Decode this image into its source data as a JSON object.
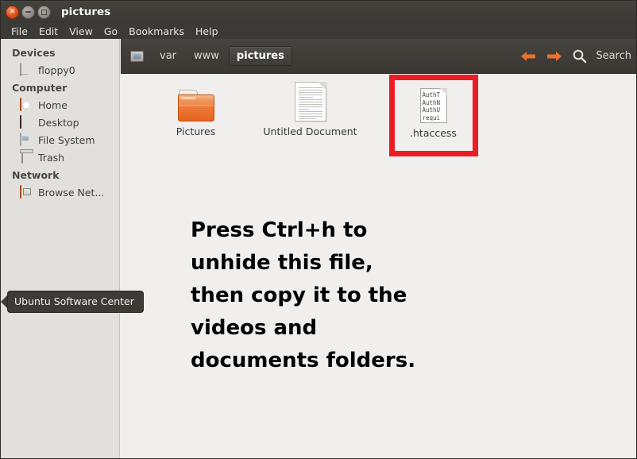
{
  "window": {
    "title": "pictures",
    "controls": {
      "close": "close-button",
      "minimize": "minimize-button",
      "maximize": "maximize-button"
    }
  },
  "menubar": {
    "items": [
      {
        "label": "File"
      },
      {
        "label": "Edit"
      },
      {
        "label": "View"
      },
      {
        "label": "Go"
      },
      {
        "label": "Bookmarks"
      },
      {
        "label": "Help"
      }
    ]
  },
  "sidebar": {
    "sections": [
      {
        "heading": "Devices",
        "items": [
          {
            "label": "floppy0",
            "icon": "floppy-drive-icon"
          }
        ]
      },
      {
        "heading": "Computer",
        "items": [
          {
            "label": "Home",
            "icon": "home-folder-icon"
          },
          {
            "label": "Desktop",
            "icon": "desktop-icon"
          },
          {
            "label": "File System",
            "icon": "file-system-icon"
          },
          {
            "label": "Trash",
            "icon": "trash-icon"
          }
        ]
      },
      {
        "heading": "Network",
        "items": [
          {
            "label": "Browse Net...",
            "icon": "network-folder-icon"
          }
        ]
      }
    ]
  },
  "toolbar": {
    "path_icon": "drive-icon",
    "breadcrumbs": [
      {
        "label": "var",
        "active": false
      },
      {
        "label": "www",
        "active": false
      },
      {
        "label": "pictures",
        "active": true
      }
    ],
    "back_icon": "back-arrow-icon",
    "forward_icon": "forward-arrow-icon",
    "search_icon": "search-icon",
    "search_label": "Search"
  },
  "files": [
    {
      "name": "Pictures",
      "type": "folder",
      "icon": "folder-icon",
      "highlighted": false
    },
    {
      "name": "Untitled Document",
      "type": "document",
      "icon": "document-icon",
      "highlighted": false
    },
    {
      "name": ".htaccess",
      "type": "text-file",
      "icon": "text-file-icon",
      "highlighted": true,
      "preview_lines": [
        "AuthT",
        "AuthN",
        "AuthU",
        "requi"
      ]
    }
  ],
  "instructions": {
    "lines": [
      "Press Ctrl+h to",
      "unhide this file,",
      "then copy it to the",
      "videos and",
      "documents folders."
    ]
  },
  "tooltip": {
    "text": "Ubuntu Software Center"
  },
  "colors": {
    "titlebar": "#3b3834",
    "menubar": "#3c3a36",
    "toolbar": "#403d39",
    "sidebar": "#e2e0dd",
    "content": "#f1efed",
    "accent_orange": "#dd4814",
    "highlight_red": "#ec1c24",
    "tooltip_bg": "#3e3b37"
  }
}
